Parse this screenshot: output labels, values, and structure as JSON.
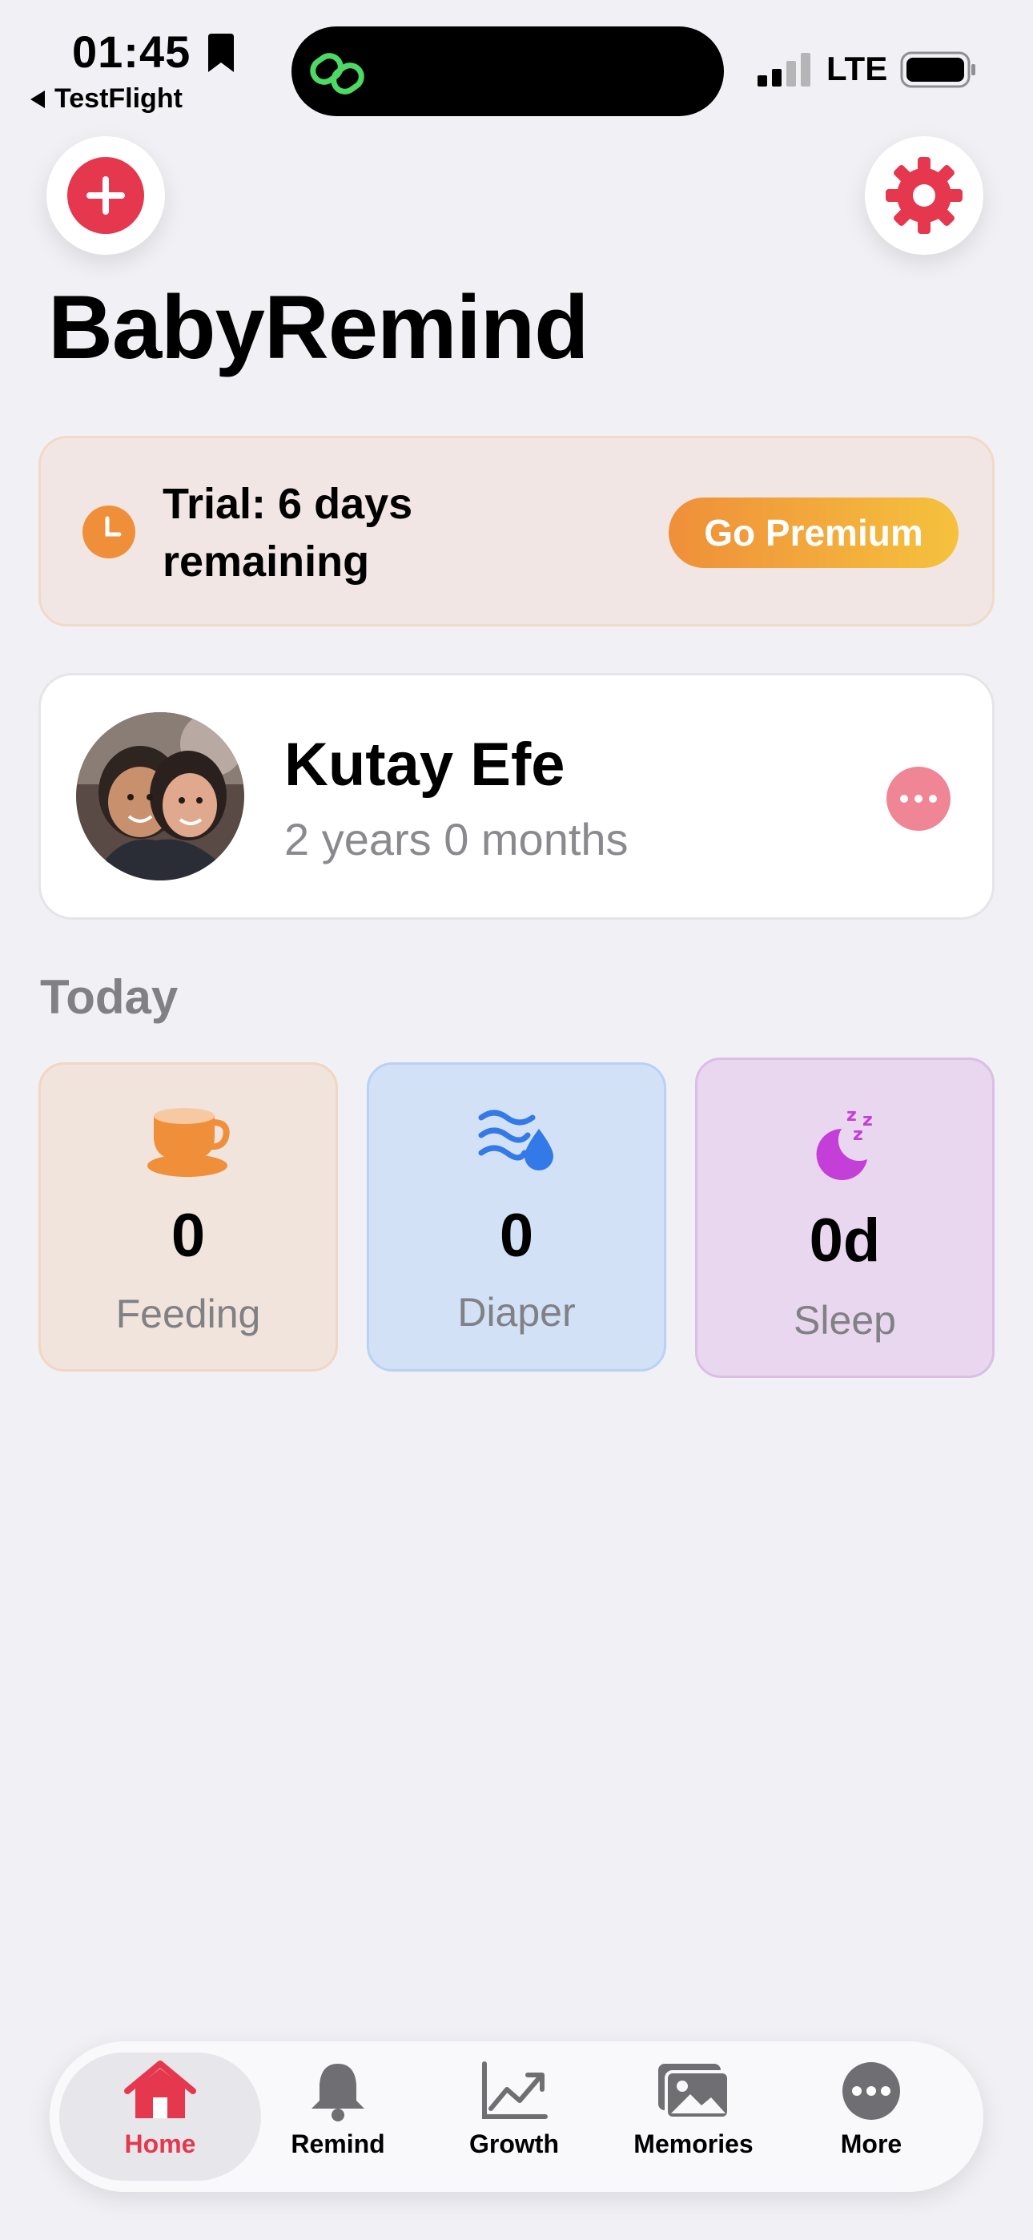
{
  "status_bar": {
    "time": "01:45",
    "back_label": "TestFlight",
    "network": "LTE",
    "icons": [
      "bookmark-icon",
      "link-icon",
      "signal-icon",
      "battery-icon"
    ]
  },
  "header": {
    "title": "BabyRemind",
    "add_icon": "plus-circle-icon",
    "settings_icon": "gear-icon"
  },
  "trial": {
    "text": "Trial: 6 days remaining",
    "button_label": "Go Premium",
    "icon": "clock-icon"
  },
  "profile": {
    "name": "Kutay Efe",
    "age": "2 years 0 months",
    "more_icon": "ellipsis-icon"
  },
  "today": {
    "title": "Today",
    "cards": [
      {
        "value": "0",
        "label": "Feeding",
        "icon": "cup-icon"
      },
      {
        "value": "0",
        "label": "Diaper",
        "icon": "water-drop-icon"
      },
      {
        "value": "0d",
        "label": "Sleep",
        "icon": "moon-zzz-icon"
      }
    ]
  },
  "tabbar": {
    "active": "Home",
    "tabs": [
      {
        "label": "Home",
        "icon": "house-icon"
      },
      {
        "label": "Remind",
        "icon": "bell-icon"
      },
      {
        "label": "Growth",
        "icon": "chart-icon"
      },
      {
        "label": "Memories",
        "icon": "photos-icon"
      },
      {
        "label": "More",
        "icon": "ellipsis-circle-icon"
      }
    ]
  },
  "colors": {
    "accent_red": "#e5384f",
    "orange": "#ef8f3a",
    "blue": "#3479e8",
    "purple": "#c43fd8",
    "background": "#f1f0f5"
  }
}
